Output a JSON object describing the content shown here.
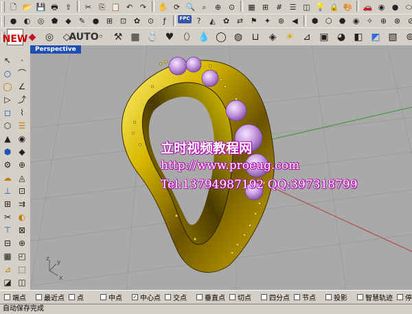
{
  "toolbar_row1": {
    "icons": [
      "new-file-icon",
      "open-folder-icon",
      "save-icon",
      "print-icon",
      "import-icon",
      "cut-icon",
      "copy-icon",
      "paste-icon",
      "undo-icon",
      "redo-icon",
      "pan-icon",
      "rotate-view-icon",
      "zoom-icon",
      "zoom-window-icon",
      "zoom-extents-icon",
      "zoom-selected-icon",
      "viewport-layout-icon",
      "four-view-icon",
      "grid-icon",
      "layer-icon",
      "object-properties-icon",
      "lightbulb-icon",
      "lock-icon",
      "palette-icon",
      "car-icon",
      "render-icon",
      "sphere-icon",
      "cylinder-icon",
      "material-icon",
      "magnifier-icon",
      "info-icon",
      "help-icon",
      "flatten-icon",
      "text-icon",
      "color-wheel-icon",
      "globe-icon",
      "box-icon",
      "analyze-icon",
      "expand-icon"
    ],
    "glyphs": [
      "🗋",
      "📂",
      "💾",
      "🖶",
      "⇪",
      "✂",
      "⎘",
      "📋",
      "↶",
      "↷",
      "✋",
      "⟳",
      "🔍",
      "⌕",
      "⊕",
      "⊙",
      "▦",
      "⊞",
      "#",
      "☰",
      "◫",
      "💡",
      "🔒",
      "🎨",
      "🚗",
      "◉",
      "●",
      "⬭",
      "◈",
      "🔎",
      "ⓘ",
      "?",
      "▭",
      "T",
      "◍",
      "🌐",
      "▣",
      "∿",
      "⤢"
    ]
  },
  "toolbar_row2": {
    "glyphs": [
      "●",
      "◐",
      "◎",
      "⬟",
      "◆",
      "✎",
      "●",
      "⊞",
      "⊡",
      "✿",
      "⊙",
      "ƒ",
      "FPC",
      "?",
      "◭",
      "✿",
      "⇄",
      "⚑",
      "✦",
      "⊛",
      "◀",
      "⬢",
      "⬡",
      "⬣",
      "◉",
      "✧",
      "⊕",
      "⊗",
      "⊘",
      "◌",
      "▤",
      "⊡",
      "⊟",
      "⊠",
      "✥",
      "◬"
    ],
    "icons": [
      "sphere-icon",
      "half-sphere-icon",
      "torus-icon",
      "polygon-icon",
      "diamond-icon",
      "pencil-icon",
      "green-ball-icon",
      "grid-snap-icon",
      "box-select-icon",
      "flower-icon",
      "target-icon",
      "function-icon",
      "fpc-icon",
      "help-circle-icon",
      "triangle-icon",
      "gem-flower-icon",
      "swap-icon",
      "flag-icon",
      "star-icon",
      "spin-icon",
      "arrow-left-icon",
      "hexagon-icon",
      "hexagon-outline-icon",
      "hexagon-filled-icon",
      "ring-icon",
      "sparkle-icon",
      "plus-circle-icon",
      "cross-circle-icon",
      "slash-circle-icon",
      "dotted-circle-icon",
      "list-icon",
      "frame-icon",
      "minus-box-icon",
      "cross-box-icon",
      "move-icon",
      "fan-icon"
    ]
  },
  "toolbar_row3": {
    "new_label": "NEW",
    "auto_label": "AUTO",
    "icons": [
      "new-document-icon",
      "ruby-gem-icon",
      "round-setting-icon",
      "square-setting-icon",
      "auto-gem-icon",
      "prong-icon",
      "hammer-icon",
      "pave-icon",
      "ring-gem-icon",
      "heart-gem-icon",
      "oval-gem-icon",
      "pear-gem-icon",
      "ring-shank-icon",
      "bezel-icon",
      "channel-icon",
      "gem-cut-icon",
      "sun-icon",
      "grid-plane-icon",
      "cube-icon",
      "sphere-shade-icon",
      "split-icon",
      "render-preview-icon",
      "selection-icon",
      "lamp-icon",
      "stone-icon",
      "pattern-icon",
      "array-icon",
      "dots-icon",
      "xyz-icon",
      "molecule-icon"
    ],
    "glyphs": [
      "",
      "◆",
      "◎",
      "◇",
      "",
      "◦",
      "⚒",
      "▦",
      "💍",
      "♥",
      "⬯",
      "💧",
      "◯",
      "◍",
      "⊔",
      "◈",
      "☀",
      "⊿",
      "▣",
      "◕",
      "◧",
      "◩",
      "▧",
      "⊚",
      "●",
      "✱",
      "⊹",
      "∴",
      "✳",
      "⁂"
    ]
  },
  "left_toolbar": {
    "glyphs": [
      "↖",
      "·",
      "○",
      "⌒",
      "◯",
      "∠",
      "▷",
      "⤴",
      "◻",
      "⌇",
      "⬡",
      "☰",
      "▲",
      "◉",
      "⬢",
      "◆",
      "⚙",
      "⊕",
      "☁",
      "◬",
      "⊥",
      "⊡",
      "⊞",
      "⇉",
      "✂",
      "◐",
      "⊤",
      "⊠",
      "⊟",
      "⊕",
      "▦",
      "◰",
      "⊿",
      "⬚",
      "◪",
      "◫"
    ],
    "icons": [
      "select-arrow-icon",
      "point-icon",
      "circle-icon",
      "arc-icon",
      "ellipse-icon",
      "angle-icon",
      "polygon-icon",
      "curve-icon",
      "rectangle-icon",
      "freeform-icon",
      "surface-icon",
      "loft-icon",
      "cone-icon",
      "sphere-icon",
      "solid-icon",
      "diamond-icon",
      "gear-icon",
      "boolean-icon",
      "patch-icon",
      "pyramid-icon",
      "extrude-icon",
      "cap-icon",
      "mesh-icon",
      "offset-icon",
      "trim-icon",
      "split-icon",
      "pipe-icon",
      "join-icon",
      "explode-icon",
      "array-icon",
      "grid-icon",
      "block-icon",
      "dimension-icon",
      "group-icon",
      "layer-icon",
      "properties-icon"
    ]
  },
  "viewport": {
    "title": "Perspective",
    "axis_x": "x",
    "axis_y": "y",
    "axis_z": "z"
  },
  "watermark": {
    "title": "立时视频教程网",
    "url": "http://www.proeug.com",
    "contact": "Tel:13794987192  QQ:397318799"
  },
  "osnaps": [
    {
      "label": "端点",
      "checked": false
    },
    {
      "label": "最近点",
      "checked": false
    },
    {
      "label": "点",
      "checked": false
    },
    {
      "label": "中点",
      "checked": false
    },
    {
      "label": "中心点",
      "checked": true
    },
    {
      "label": "交点",
      "checked": false
    },
    {
      "label": "垂直点",
      "checked": false
    },
    {
      "label": "切点",
      "checked": false
    },
    {
      "label": "四分点",
      "checked": false
    },
    {
      "label": "节点",
      "checked": false
    },
    {
      "label": "投影",
      "checked": false
    },
    {
      "label": "智慧轨迹",
      "checked": false
    },
    {
      "label": "停",
      "checked": false
    }
  ],
  "status": {
    "message": "自动保存完成"
  },
  "colors": {
    "viewport_bg": "#a9a9a9",
    "tab_bg": "#1f4fb5",
    "gold": "#c9a800",
    "amethyst": "#c79ae0",
    "watermark_outline": "#b000b0"
  }
}
